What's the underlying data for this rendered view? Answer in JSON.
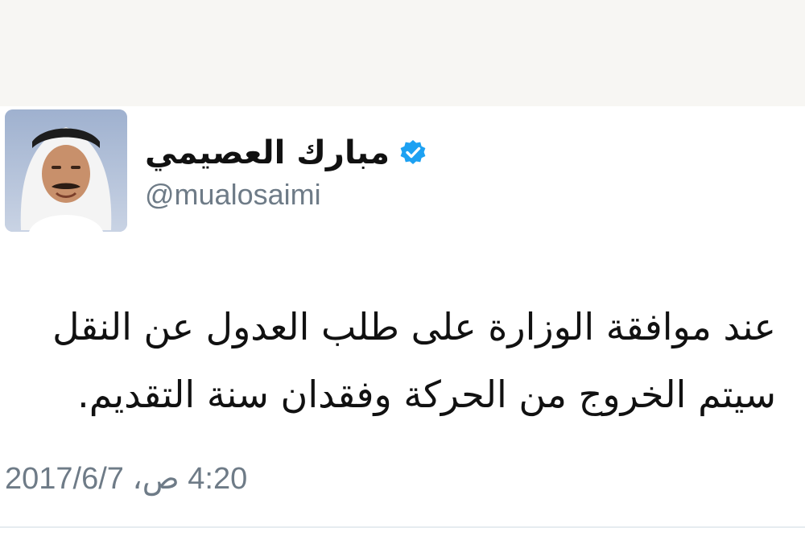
{
  "tweet": {
    "author": {
      "display_name": "مبارك العصيمي",
      "handle": "@mualosaimi",
      "verified": true,
      "verified_icon": "verified-badge-icon",
      "avatar": "profile-photo"
    },
    "text_lines": [
      "عند موافقة الوزارة على طلب العدول عن النقل",
      "سيتم الخروج من الحركة وفقدان سنة التقديم."
    ],
    "timestamp": "4:20 ص، 2017/6/7"
  },
  "colors": {
    "verified_blue": "#1da1f2",
    "secondary_text": "#6e7b87",
    "primary_text": "#111111"
  }
}
